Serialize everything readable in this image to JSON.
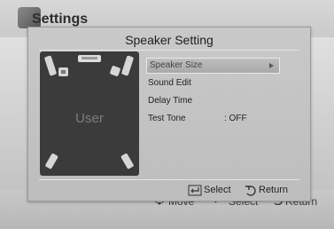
{
  "background": {
    "title": "Settings",
    "footer": {
      "move_label": "Move",
      "select_label": "Select",
      "return_label": "Return"
    }
  },
  "dialog": {
    "title": "Speaker Setting",
    "panel_label": "User",
    "menu": [
      {
        "label": "Speaker Size",
        "selected": true,
        "icon": "chevron-right-icon"
      },
      {
        "label": "Sound Edit"
      },
      {
        "label": "Delay Time"
      },
      {
        "label": "Test Tone",
        "value": ": OFF"
      }
    ],
    "hints": {
      "select_label": "Select",
      "return_label": "Return"
    }
  },
  "colors": {
    "dialog_bg": "#c4c4c4",
    "panel_bg": "#3b3b3b",
    "text": "#1e1e1e",
    "highlight": "#e9e9e9"
  }
}
